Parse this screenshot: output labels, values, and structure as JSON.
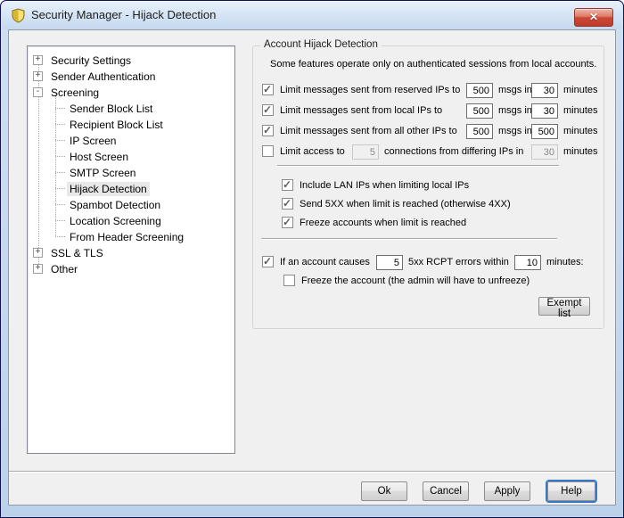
{
  "window": {
    "title": "Security Manager - Hijack Detection",
    "close_glyph": "✕",
    "app_icon": "shield-icon"
  },
  "colors": {
    "titlebar": "#d8e6f6",
    "client_bg": "#f0f0f0",
    "close_red": "#c03a2b",
    "focus_blue": "#3579c8",
    "check_gray": "#5f5f5f",
    "selection_bg": "#e8e8e8"
  },
  "sidebar": {
    "items": [
      {
        "label": "Security Settings",
        "glyph": "+",
        "level": 0
      },
      {
        "label": "Sender Authentication",
        "glyph": "+",
        "level": 0
      },
      {
        "label": "Screening",
        "glyph": "-",
        "level": 0
      },
      {
        "label": "Sender Block List",
        "level": 1
      },
      {
        "label": "Recipient Block List",
        "level": 1
      },
      {
        "label": "IP Screen",
        "level": 1
      },
      {
        "label": "Host Screen",
        "level": 1
      },
      {
        "label": "SMTP Screen",
        "level": 1
      },
      {
        "label": "Hijack Detection",
        "level": 1,
        "selected": true
      },
      {
        "label": "Spambot Detection",
        "level": 1
      },
      {
        "label": "Location Screening",
        "level": 1
      },
      {
        "label": "From Header Screening",
        "level": 1
      },
      {
        "label": "SSL & TLS",
        "glyph": "+",
        "level": 0
      },
      {
        "label": "Other",
        "glyph": "+",
        "level": 0
      }
    ]
  },
  "panel": {
    "group_title": "Account Hijack Detection",
    "note": "Some features operate only on authenticated sessions from local accounts.",
    "rows": {
      "reserved": {
        "checked": true,
        "label": "Limit messages sent from reserved IPs to",
        "msgs": "500",
        "mid": "msgs in",
        "mins": "30",
        "unit": "minutes"
      },
      "local": {
        "checked": true,
        "label": "Limit messages sent from local IPs to",
        "msgs": "500",
        "mid": "msgs in",
        "mins": "30",
        "unit": "minutes"
      },
      "other": {
        "checked": true,
        "label": "Limit messages sent from all other IPs to",
        "msgs": "500",
        "mid": "msgs in",
        "mins": "500",
        "unit": "minutes"
      },
      "access": {
        "checked": false,
        "label": "Limit access to",
        "conns": "5",
        "mid": "connections from differing IPs in",
        "mins": "30",
        "unit": "minutes"
      }
    },
    "options": [
      {
        "checked": true,
        "label": "Include LAN IPs when limiting local IPs"
      },
      {
        "checked": true,
        "label": "Send 5XX when limit is reached (otherwise 4XX)"
      },
      {
        "checked": true,
        "label": "Freeze accounts when limit is reached"
      }
    ],
    "rcpt": {
      "checked": true,
      "label": "If an account causes",
      "count": "5",
      "mid": "5xx RCPT errors within",
      "mins": "10",
      "unit": "minutes:"
    },
    "freeze": {
      "checked": false,
      "label": "Freeze the account (the admin will have to unfreeze)"
    },
    "exempt_button": "Exempt list"
  },
  "footer": {
    "buttons": [
      "Ok",
      "Cancel",
      "Apply",
      "Help"
    ]
  }
}
